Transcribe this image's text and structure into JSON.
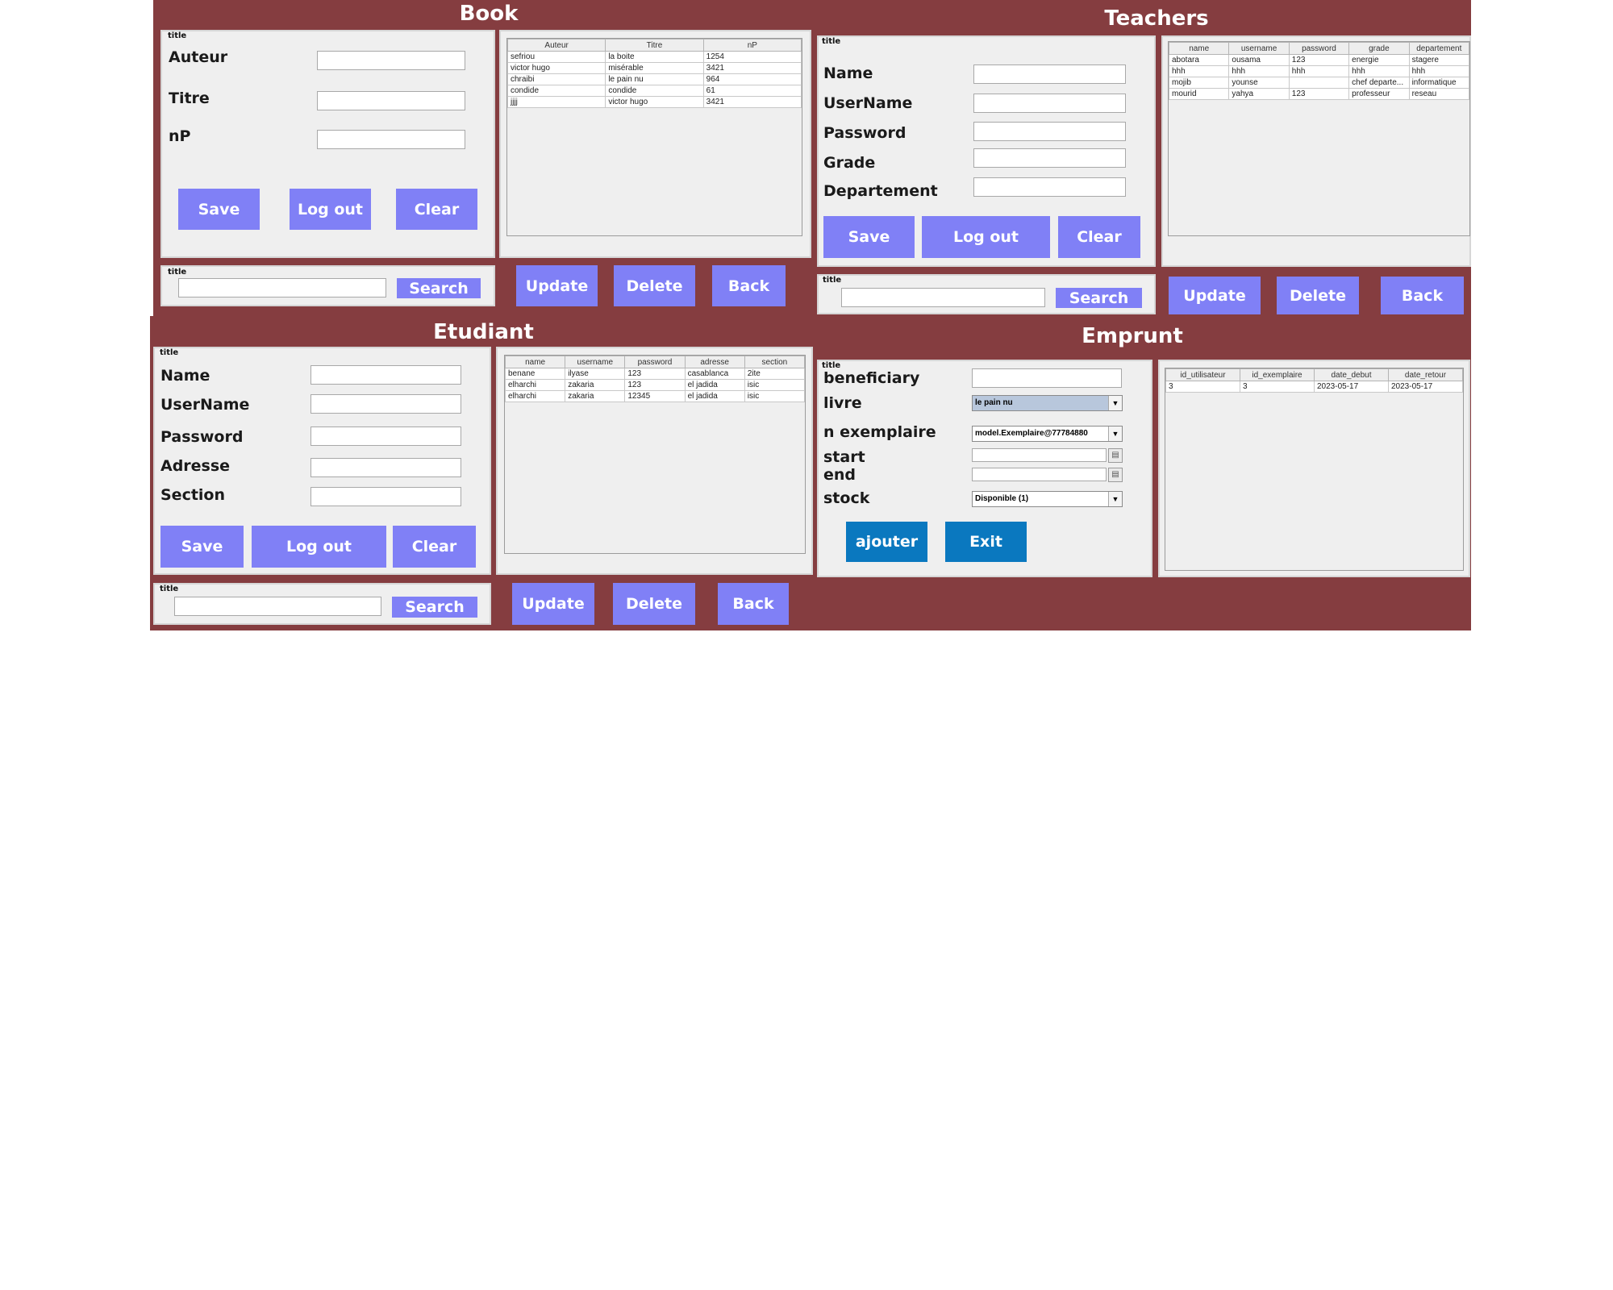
{
  "book": {
    "title": "Book",
    "form_tag": "title",
    "fields": [
      {
        "label": "Auteur",
        "value": ""
      },
      {
        "label": "Titre",
        "value": ""
      },
      {
        "label": "nP",
        "value": ""
      }
    ],
    "buttons": {
      "save": "Save",
      "logout": "Log out",
      "clear": "Clear"
    },
    "search": {
      "tag": "title",
      "value": "",
      "button": "Search"
    },
    "actions": {
      "update": "Update",
      "delete": "Delete",
      "back": "Back"
    },
    "table": {
      "columns": [
        "Auteur",
        "Titre",
        "nP"
      ],
      "rows": [
        [
          "sefriou",
          "la boite",
          "1254"
        ],
        [
          "victor hugo",
          "misérable",
          "3421"
        ],
        [
          "chraibi",
          "le pain nu",
          "964"
        ],
        [
          "condide",
          "condide",
          "61"
        ],
        [
          "jjjj",
          "victor hugo",
          "3421"
        ]
      ]
    }
  },
  "teachers": {
    "title": "Teachers",
    "form_tag": "title",
    "fields": [
      {
        "label": "Name",
        "value": ""
      },
      {
        "label": "UserName",
        "value": ""
      },
      {
        "label": "Password",
        "value": ""
      },
      {
        "label": "Grade",
        "value": ""
      },
      {
        "label": "Departement",
        "value": ""
      }
    ],
    "buttons": {
      "save": "Save",
      "logout": "Log out",
      "clear": "Clear"
    },
    "search": {
      "tag": "title",
      "value": "",
      "button": "Search"
    },
    "actions": {
      "update": "Update",
      "delete": "Delete",
      "back": "Back"
    },
    "table": {
      "columns": [
        "name",
        "username",
        "password",
        "grade",
        "departement"
      ],
      "rows": [
        [
          "abotara",
          "ousama",
          "123",
          "energie",
          "stagere"
        ],
        [
          "hhh",
          "hhh",
          "hhh",
          "hhh",
          "hhh"
        ],
        [
          "mojib",
          "younse",
          "",
          "chef departe...",
          "informatique"
        ],
        [
          "mourid",
          "yahya",
          "123",
          "professeur",
          "reseau"
        ]
      ]
    }
  },
  "etudiant": {
    "title": "Etudiant",
    "form_tag": "title",
    "fields": [
      {
        "label": "Name",
        "value": ""
      },
      {
        "label": "UserName",
        "value": ""
      },
      {
        "label": "Password",
        "value": ""
      },
      {
        "label": "Adresse",
        "value": ""
      },
      {
        "label": "Section",
        "value": ""
      }
    ],
    "buttons": {
      "save": "Save",
      "logout": "Log out",
      "clear": "Clear"
    },
    "search": {
      "tag": "title",
      "value": "",
      "button": "Search"
    },
    "actions": {
      "update": "Update",
      "delete": "Delete",
      "back": "Back"
    },
    "table": {
      "columns": [
        "name",
        "username",
        "password",
        "adresse",
        "section"
      ],
      "rows": [
        [
          "benane",
          "ilyase",
          "123",
          "casablanca",
          "2ite"
        ],
        [
          "elharchi",
          "zakaria",
          "123",
          "el jadida",
          "isic"
        ],
        [
          "elharchi",
          "zakaria",
          "12345",
          "el jadida",
          "isic"
        ]
      ]
    }
  },
  "emprunt": {
    "title": "Emprunt",
    "form_tag": "title",
    "labels": {
      "beneficiary": "beneficiary",
      "livre": "livre",
      "exemplaire": "n exemplaire",
      "start": "start",
      "end": "end",
      "stock": "stock"
    },
    "values": {
      "beneficiary": "",
      "livre": "le pain nu",
      "exemplaire": "model.Exemplaire@77784880",
      "start": "",
      "end": "",
      "stock": "Disponible (1)"
    },
    "buttons": {
      "ajouter": "ajouter",
      "exit": "Exit"
    },
    "table": {
      "columns": [
        "id_utilisateur",
        "id_exemplaire",
        "date_debut",
        "date_retour"
      ],
      "rows": [
        [
          "3",
          "3",
          "2023-05-17",
          "2023-05-17"
        ]
      ]
    }
  },
  "icons": {
    "dropdown": "chevron-down-icon",
    "calendar": "calendar-icon"
  },
  "colors": {
    "frame": "#853d40",
    "button": "#8080f6",
    "button_alt": "#0a78bf",
    "panel": "#efefef"
  }
}
